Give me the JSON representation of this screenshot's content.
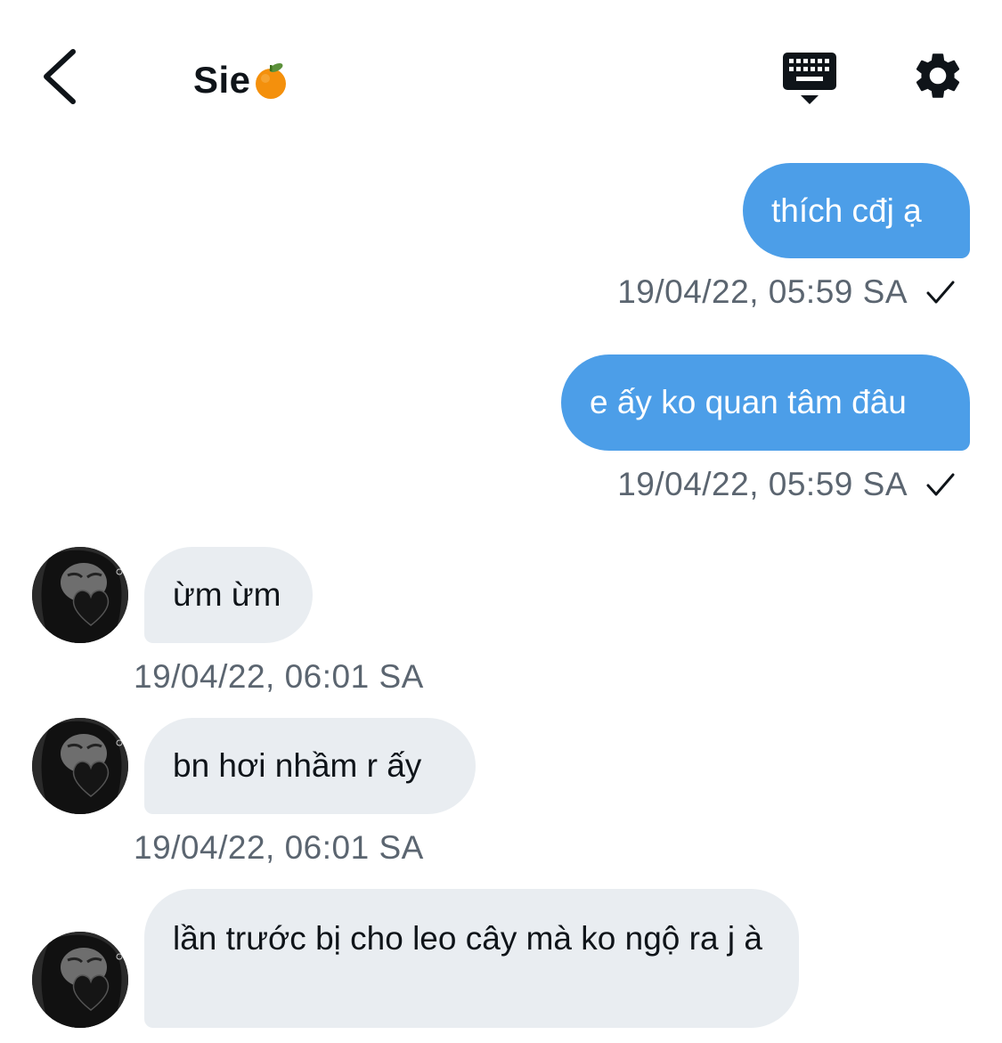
{
  "header": {
    "title": "Sie",
    "title_emoji_icon": "tangerine-icon",
    "back_icon": "chevron-left-icon",
    "keyboard_icon": "keyboard-icon",
    "settings_icon": "gear-icon"
  },
  "colors": {
    "sent_bubble": "#4c9ee8",
    "received_bubble": "#e9edf1",
    "timestamp": "#5b6570"
  },
  "messages": [
    {
      "direction": "sent",
      "text": "thích cđj ạ",
      "timestamp": "19/04/22, 05:59 SA",
      "status_icon": "check-icon"
    },
    {
      "direction": "sent",
      "text": "e ấy ko quan tâm đâu",
      "timestamp": "19/04/22, 05:59 SA",
      "status_icon": "check-icon"
    },
    {
      "direction": "received",
      "text": "ừm ừm",
      "timestamp": "19/04/22, 06:01 SA"
    },
    {
      "direction": "received",
      "text": "bn hơi nhầm r ấy",
      "timestamp": "19/04/22, 06:01 SA"
    },
    {
      "direction": "received",
      "text": "lần trước bị cho leo cây mà ko ngộ ra j à"
    }
  ]
}
